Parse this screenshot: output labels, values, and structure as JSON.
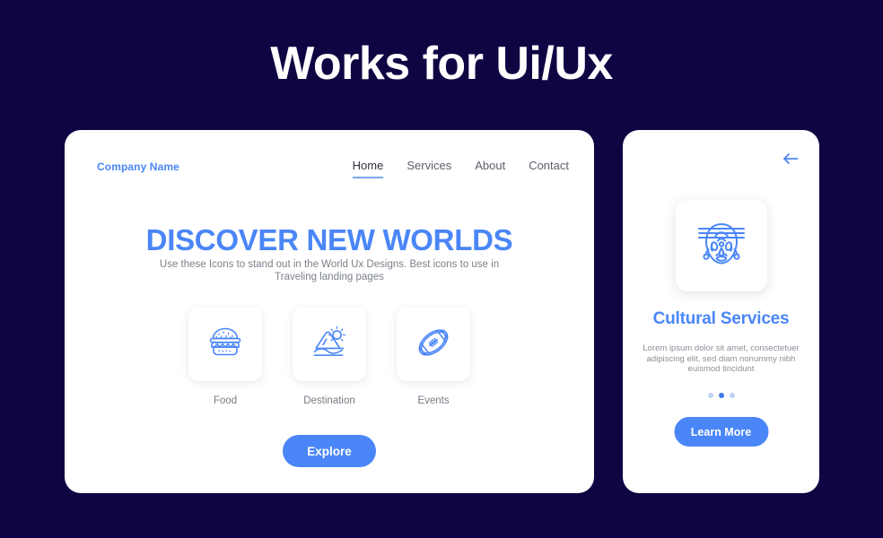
{
  "page": {
    "title": "Works for Ui/Ux",
    "background_color": "#100443",
    "accent_color": "#4a86f7"
  },
  "left_card": {
    "brand": "Company Name",
    "nav": [
      {
        "label": "Home",
        "active": true
      },
      {
        "label": "Services",
        "active": false
      },
      {
        "label": "About",
        "active": false
      },
      {
        "label": "Contact",
        "active": false
      }
    ],
    "hero_title": "DISCOVER NEW WORLDS",
    "hero_subtitle": "Use these Icons to stand out in the World Ux Designs. Best icons to use in Traveling landing pages",
    "tiles": [
      {
        "label": "Food",
        "icon": "hamburger-icon"
      },
      {
        "label": "Destination",
        "icon": "mountain-sun-icon"
      },
      {
        "label": "Events",
        "icon": "football-icon"
      }
    ],
    "cta_label": "Explore"
  },
  "right_card": {
    "back_icon": "arrow-left-icon",
    "hero_icon": "tribal-mask-icon",
    "title": "Cultural Services",
    "body": "Lorem ipsum dolor sit amet, consectetuer adipiscing elit, sed diam nonummy nibh euismod tincidunt",
    "dots": [
      {
        "active": false
      },
      {
        "active": true
      },
      {
        "active": false
      }
    ],
    "cta_label": "Learn More"
  }
}
